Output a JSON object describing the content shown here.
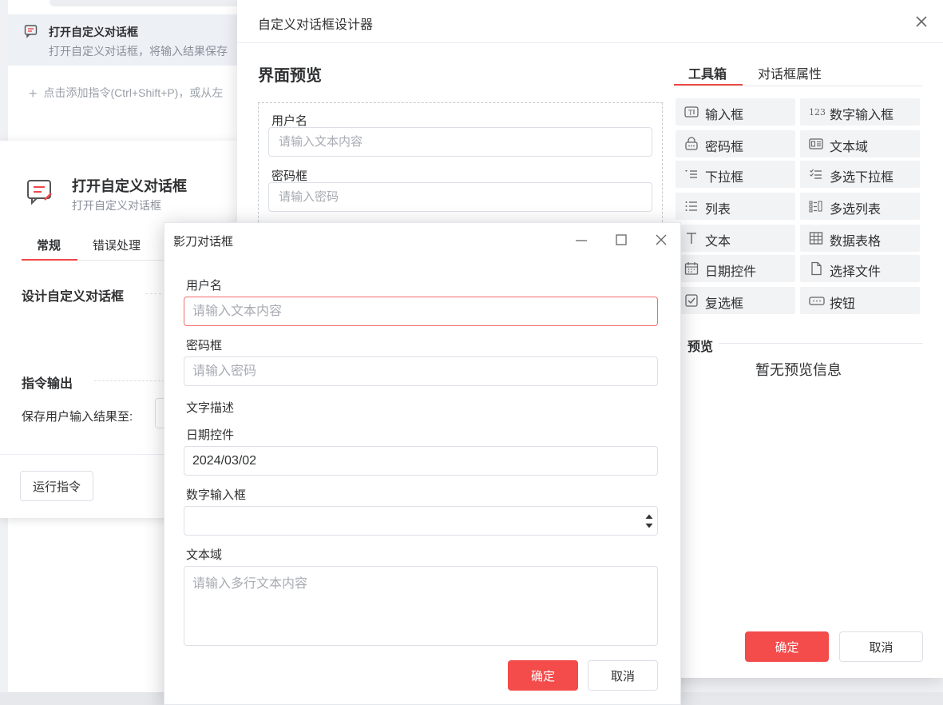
{
  "background": {
    "command_row": {
      "title": "打开自定义对话框",
      "subtitle": "打开自定义对话框，将输入结果保存"
    },
    "add_command_hint": "点击添加指令(Ctrl+Shift+P)，或从左"
  },
  "property_panel": {
    "title": "打开自定义对话框",
    "subtitle": "打开自定义对话框",
    "tabs": [
      "常规",
      "错误处理"
    ],
    "active_tab": "常规",
    "section_design": "设计自定义对话框",
    "section_output": "指令输出",
    "save_label": "保存用户输入结果至:",
    "run_button": "运行指令"
  },
  "designer": {
    "title": "自定义对话框设计器",
    "preview_heading": "界面预览",
    "canvas_fields": [
      {
        "label": "用户名",
        "placeholder": "请输入文本内容"
      },
      {
        "label": "密码框",
        "placeholder": "请输入密码"
      }
    ],
    "tabs": [
      "工具箱",
      "对话框属性"
    ],
    "active_tab": "工具箱",
    "tools": [
      {
        "label": "输入框",
        "icon": "text-input-icon"
      },
      {
        "label": "数字输入框",
        "icon": "number-123-icon"
      },
      {
        "label": "密码框",
        "icon": "password-icon"
      },
      {
        "label": "文本域",
        "icon": "textarea-icon"
      },
      {
        "label": "下拉框",
        "icon": "dropdown-icon"
      },
      {
        "label": "多选下拉框",
        "icon": "multi-dropdown-icon"
      },
      {
        "label": "列表",
        "icon": "list-icon"
      },
      {
        "label": "多选列表",
        "icon": "multi-list-icon"
      },
      {
        "label": "文本",
        "icon": "text-t-icon"
      },
      {
        "label": "数据表格",
        "icon": "table-grid-icon"
      },
      {
        "label": "日期控件",
        "icon": "calendar-icon"
      },
      {
        "label": "选择文件",
        "icon": "file-icon"
      },
      {
        "label": "复选框",
        "icon": "checkbox-icon"
      },
      {
        "label": "按钮",
        "icon": "button-icon"
      }
    ],
    "preview_section": "预览",
    "no_preview": "暂无预览信息",
    "ok_button": "确定",
    "cancel_button": "取消"
  },
  "dialog": {
    "title": "影刀对话框",
    "username_label": "用户名",
    "username_placeholder": "请输入文本内容",
    "password_label": "密码框",
    "password_placeholder": "请输入密码",
    "text_description": "文字描述",
    "date_label": "日期控件",
    "date_value": "2024/03/02",
    "number_label": "数字输入框",
    "textarea_label": "文本域",
    "textarea_placeholder": "请输入多行文本内容",
    "ok_button": "确定",
    "cancel_button": "取消"
  },
  "colors": {
    "accent": "#f44b4b",
    "error_border": "#f56c6c"
  }
}
